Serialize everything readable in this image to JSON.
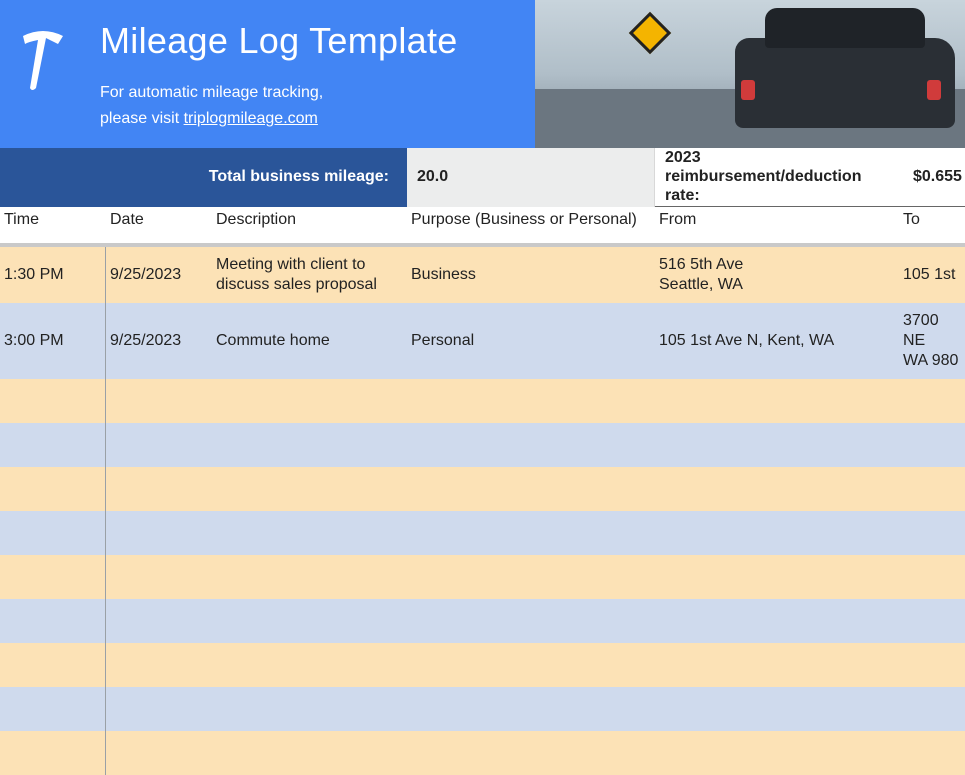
{
  "hero": {
    "title": "Mileage Log Template",
    "subtitle_line1": "For automatic mileage tracking,",
    "subtitle_line2_prefix": "please visit ",
    "subtitle_link_text": "triplogmileage.com"
  },
  "summary": {
    "total_label": "Total business mileage:",
    "total_value": "20.0",
    "rate_label": "2023 reimbursement/deduction rate:",
    "rate_value": "$0.655"
  },
  "columns": {
    "time": "Time",
    "date": "Date",
    "description": "Description",
    "purpose": "Purpose (Business or Personal)",
    "from": "From",
    "to": "To"
  },
  "rows": [
    {
      "time": "1:30 PM",
      "date": "9/25/2023",
      "description": "Meeting with client to discuss sales proposal",
      "purpose": "Business",
      "from": "516 5th Ave\nSeattle, WA",
      "to": "105 1st"
    },
    {
      "time": "3:00 PM",
      "date": "9/25/2023",
      "description": "Commute home",
      "purpose": "Personal",
      "from": "105 1st Ave N, Kent, WA",
      "to": "3700 NE\nWA 980"
    }
  ],
  "empty_row_count": 9
}
